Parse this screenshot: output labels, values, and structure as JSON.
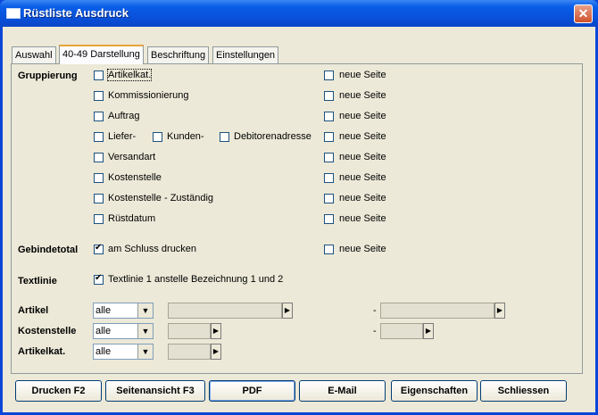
{
  "window": {
    "title": "Rüstliste Ausdruck",
    "close_symbol": "✕"
  },
  "tabs": [
    "Auswahl",
    "40-49 Darstellung",
    "Beschriftung",
    "Einstellungen"
  ],
  "gruppierung": {
    "label": "Gruppierung",
    "items": [
      {
        "label": "Artikelkat.",
        "checked": false
      },
      {
        "label": "Kommissionierung",
        "checked": false
      },
      {
        "label": "Auftrag",
        "checked": false
      },
      {
        "label": "Liefer-",
        "checked": false
      },
      {
        "label": "Versandart",
        "checked": false
      },
      {
        "label": "Kostenstelle",
        "checked": false
      },
      {
        "label": "Kostenstelle - Zuständig",
        "checked": false
      },
      {
        "label": "Rüstdatum",
        "checked": false
      }
    ],
    "kunden_label": "Kunden-",
    "debitor_label": "Debitorenadresse",
    "neue_seite": "neue Seite"
  },
  "gebindetotal": {
    "label": "Gebindetotal",
    "option": "am Schluss drucken",
    "neue_seite": "neue Seite"
  },
  "textlinie": {
    "label": "Textlinie",
    "option": "Textlinie 1 anstelle Bezeichnung 1 und 2"
  },
  "filters": [
    {
      "label": "Artikel",
      "value": "alle"
    },
    {
      "label": "Kostenstelle",
      "value": "alle"
    },
    {
      "label": "Artikelkat.",
      "value": "alle"
    }
  ],
  "dash": "-",
  "buttons": [
    "Drucken F2",
    "Seitenansicht F3",
    "PDF",
    "E-Mail",
    "Eigenschaften",
    "Schliessen"
  ]
}
